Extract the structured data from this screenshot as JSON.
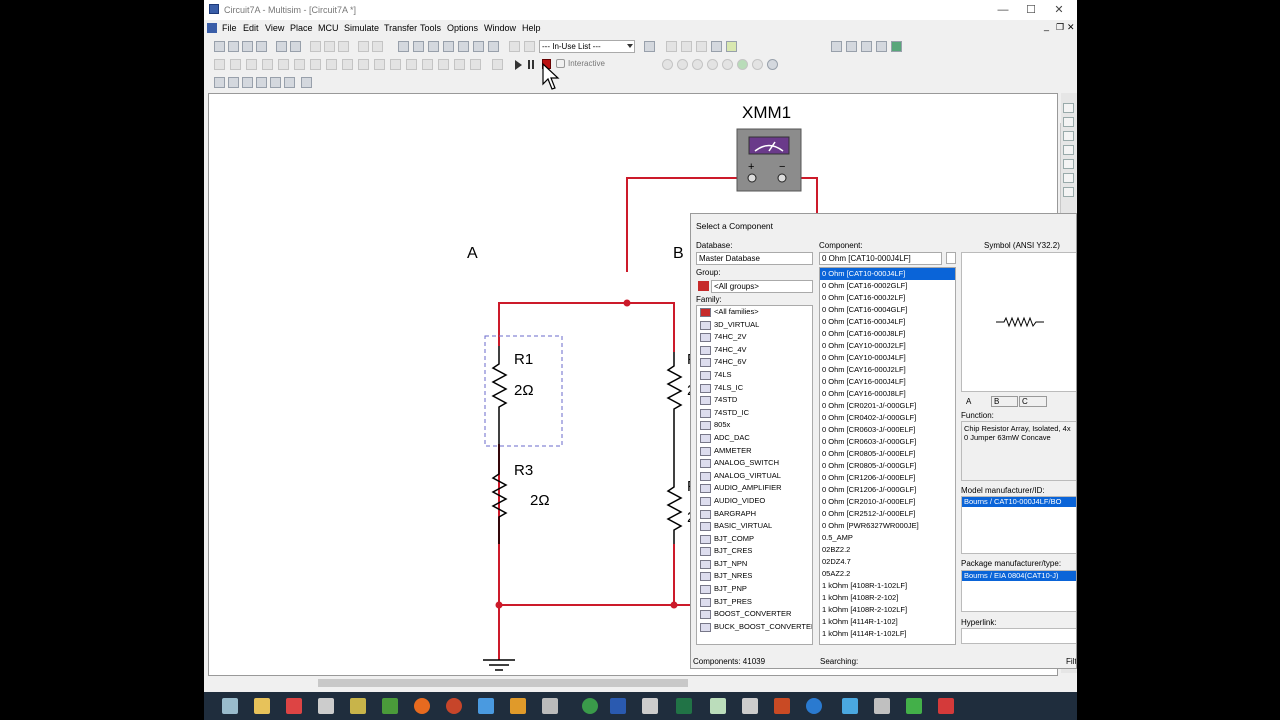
{
  "window": {
    "title": "Circuit7A - Multisim - [Circuit7A *]",
    "controls": [
      "—",
      "☐",
      "✕"
    ],
    "mdi_controls": [
      "_",
      "❐",
      "✕"
    ]
  },
  "menu": [
    "File",
    "Edit",
    "View",
    "Place",
    "MCU",
    "Simulate",
    "Transfer",
    "Tools",
    "Options",
    "Window",
    "Help"
  ],
  "toolbar": {
    "in_use_list": "--- In-Use List ---",
    "interactive_label": "Interactive"
  },
  "schematic": {
    "instrument": "XMM1",
    "node_a": "A",
    "node_b": "B",
    "r1_name": "R1",
    "r1_value": "2Ω",
    "r3_name": "R3",
    "r3_value": "2Ω",
    "partial_ref_1": "F",
    "partial_ref_2": "F",
    "partial_val_1": "2",
    "partial_val_2": "2"
  },
  "dialog": {
    "title": "Select a Component",
    "database_label": "Database:",
    "database_value": "Master Database",
    "group_label": "Group:",
    "group_value": "<All groups>",
    "family_label": "Family:",
    "families": [
      "<All families>",
      "3D_VIRTUAL",
      "74HC_2V",
      "74HC_4V",
      "74HC_6V",
      "74LS",
      "74LS_IC",
      "74STD",
      "74STD_IC",
      "805x",
      "ADC_DAC",
      "AMMETER",
      "ANALOG_SWITCH",
      "ANALOG_VIRTUAL",
      "AUDIO_AMPLIFIER",
      "AUDIO_VIDEO",
      "BARGRAPH",
      "BASIC_VIRTUAL",
      "BJT_COMP",
      "BJT_CRES",
      "BJT_NPN",
      "BJT_NRES",
      "BJT_PNP",
      "BJT_PRES",
      "BOOST_CONVERTER",
      "BUCK_BOOST_CONVERTER"
    ],
    "component_label": "Component:",
    "component_value": "0 Ohm  [CAT10-000J4LF]",
    "components": [
      "0 Ohm  [CAT10-000J4LF]",
      "0 Ohm  [CAT16-0002GLF]",
      "0 Ohm  [CAT16-000J2LF]",
      "0 Ohm  [CAT16-0004GLF]",
      "0 Ohm  [CAT16-000J4LF]",
      "0 Ohm  [CAT16-000J8LF]",
      "0 Ohm  [CAY10-000J2LF]",
      "0 Ohm  [CAY10-000J4LF]",
      "0 Ohm  [CAY16-000J2LF]",
      "0 Ohm  [CAY16-000J4LF]",
      "0 Ohm  [CAY16-000J8LF]",
      "0 Ohm  [CR0201-J/-000GLF]",
      "0 Ohm  [CR0402-J/-000GLF]",
      "0 Ohm  [CR0603-J/-000ELF]",
      "0 Ohm  [CR0603-J/-000GLF]",
      "0 Ohm  [CR0805-J/-000ELF]",
      "0 Ohm  [CR0805-J/-000GLF]",
      "0 Ohm  [CR1206-J/-000ELF]",
      "0 Ohm  [CR1206-J/-000GLF]",
      "0 Ohm  [CR2010-J/-000ELF]",
      "0 Ohm  [CR2512-J/-000ELF]",
      "0 Ohm  [PWR6327WR000JE]",
      "0.5_AMP",
      "02BZ2.2",
      "02DZ4.7",
      "05AZ2.2",
      "1 kOhm  [4108R-1-102LF]",
      "1 kOhm  [4108R-2-102]",
      "1 kOhm  [4108R-2-102LF]",
      "1 kOhm  [4114R-1-102]",
      "1 kOhm  [4114R-1-102LF]"
    ],
    "symbol_label": "Symbol (ANSI Y32.2)",
    "symbol_tabs": [
      "A",
      "B",
      "C"
    ],
    "function_label": "Function:",
    "function_text": "Chip Resistor Array, Isolated, 4x 0 Jumper 63mW Concave",
    "model_label": "Model manufacturer/ID:",
    "model_value": "Bourns / CAT10-000J4LF/BO",
    "package_label": "Package manufacturer/type:",
    "package_value": "Bourns / EIA 0804(CAT10-J)",
    "hyperlink_label": "Hyperlink:",
    "components_count": "Components: 41039",
    "searching": "Searching:",
    "filter": "Filt"
  },
  "colors": {
    "wire": "#cc1a2a",
    "selection": "#0a64d8",
    "taskbar": "#1f2d3d"
  }
}
